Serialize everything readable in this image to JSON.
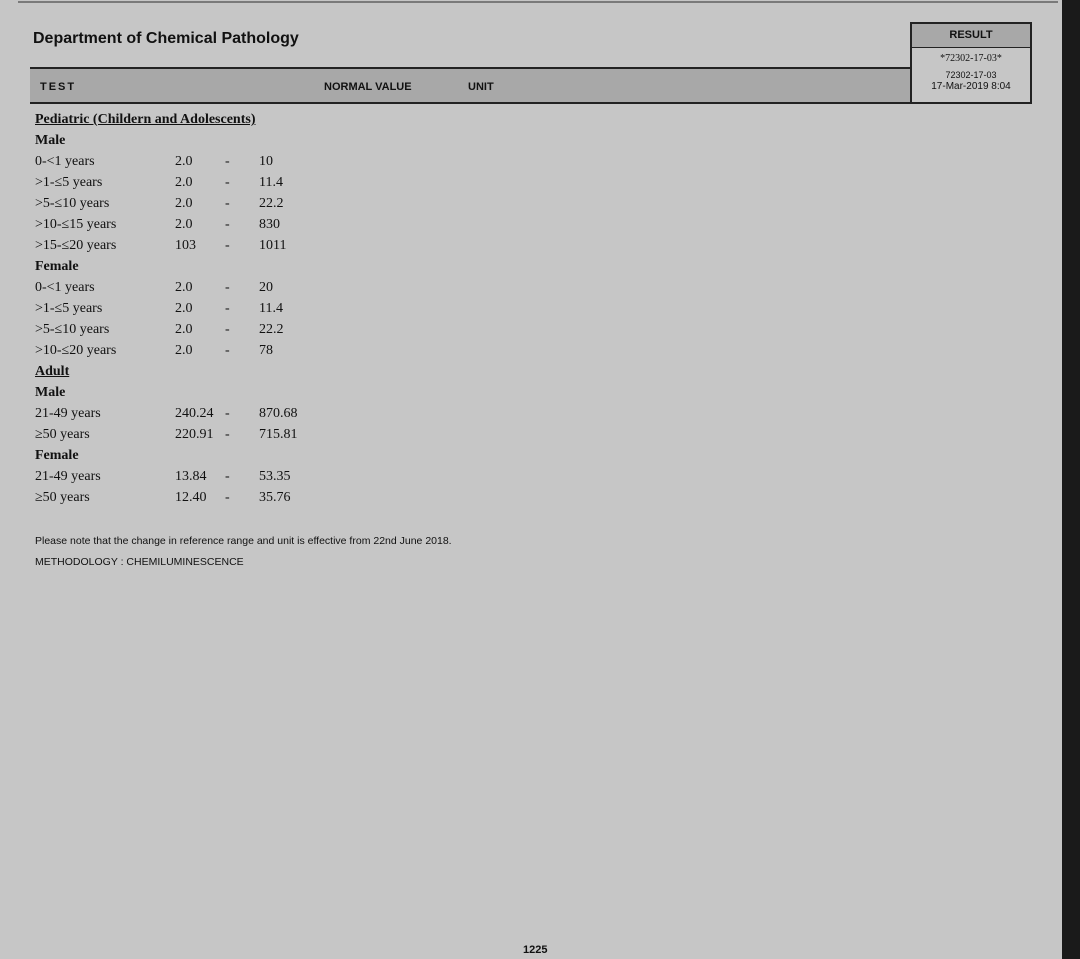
{
  "header": {
    "department": "Department of Chemical Pathology",
    "columns": {
      "test": "TEST",
      "normal_value": "NORMAL VALUE",
      "unit": "UNIT"
    }
  },
  "result_box": {
    "title": "RESULT",
    "barcode_text": "*72302-17-03*",
    "sample_id": "72302-17-03",
    "datetime": "17-Mar-2019  8:04"
  },
  "reference_table": [
    {
      "type": "section",
      "label": "Pediatric (Childern and Adolescents)"
    },
    {
      "type": "group",
      "label": "Male"
    },
    {
      "type": "row",
      "label": "0-<1 years",
      "low": "2.0",
      "dash": "-",
      "high": "10"
    },
    {
      "type": "row",
      "label": ">1-≤5 years",
      "low": "2.0",
      "dash": "-",
      "high": "11.4"
    },
    {
      "type": "row",
      "label": ">5-≤10 years",
      "low": "2.0",
      "dash": "-",
      "high": "22.2"
    },
    {
      "type": "row",
      "label": ">10-≤15 years",
      "low": "2.0",
      "dash": "-",
      "high": "830"
    },
    {
      "type": "row",
      "label": ">15-≤20 years",
      "low": "103",
      "dash": "-",
      "high": "1011"
    },
    {
      "type": "group",
      "label": "Female"
    },
    {
      "type": "row",
      "label": "0-<1 years",
      "low": "2.0",
      "dash": "-",
      "high": "20"
    },
    {
      "type": "row",
      "label": ">1-≤5 years",
      "low": "2.0",
      "dash": "-",
      "high": "11.4"
    },
    {
      "type": "row",
      "label": ">5-≤10 years",
      "low": "2.0",
      "dash": "-",
      "high": "22.2"
    },
    {
      "type": "row",
      "label": ">10-≤20 years",
      "low": "2.0",
      "dash": "-",
      "high": "78"
    },
    {
      "type": "section",
      "label": "Adult"
    },
    {
      "type": "group",
      "label": "Male"
    },
    {
      "type": "row",
      "label": "21-49 years",
      "low": "240.24",
      "dash": "-",
      "high": "870.68"
    },
    {
      "type": "row",
      "label": "≥50  years",
      "low": "220.91",
      "dash": "-",
      "high": "715.81"
    },
    {
      "type": "group",
      "label": "Female"
    },
    {
      "type": "row",
      "label": "21-49 years",
      "low": "13.84",
      "dash": "-",
      "high": "53.35"
    },
    {
      "type": "row",
      "label": "≥50  years",
      "low": "12.40",
      "dash": "-",
      "high": "35.76"
    }
  ],
  "note": "Please note that the change in reference range and unit  is effective from 22nd June  2018.",
  "methodology": "METHODOLOGY : CHEMILUMINESCENCE",
  "page_number": "1225"
}
